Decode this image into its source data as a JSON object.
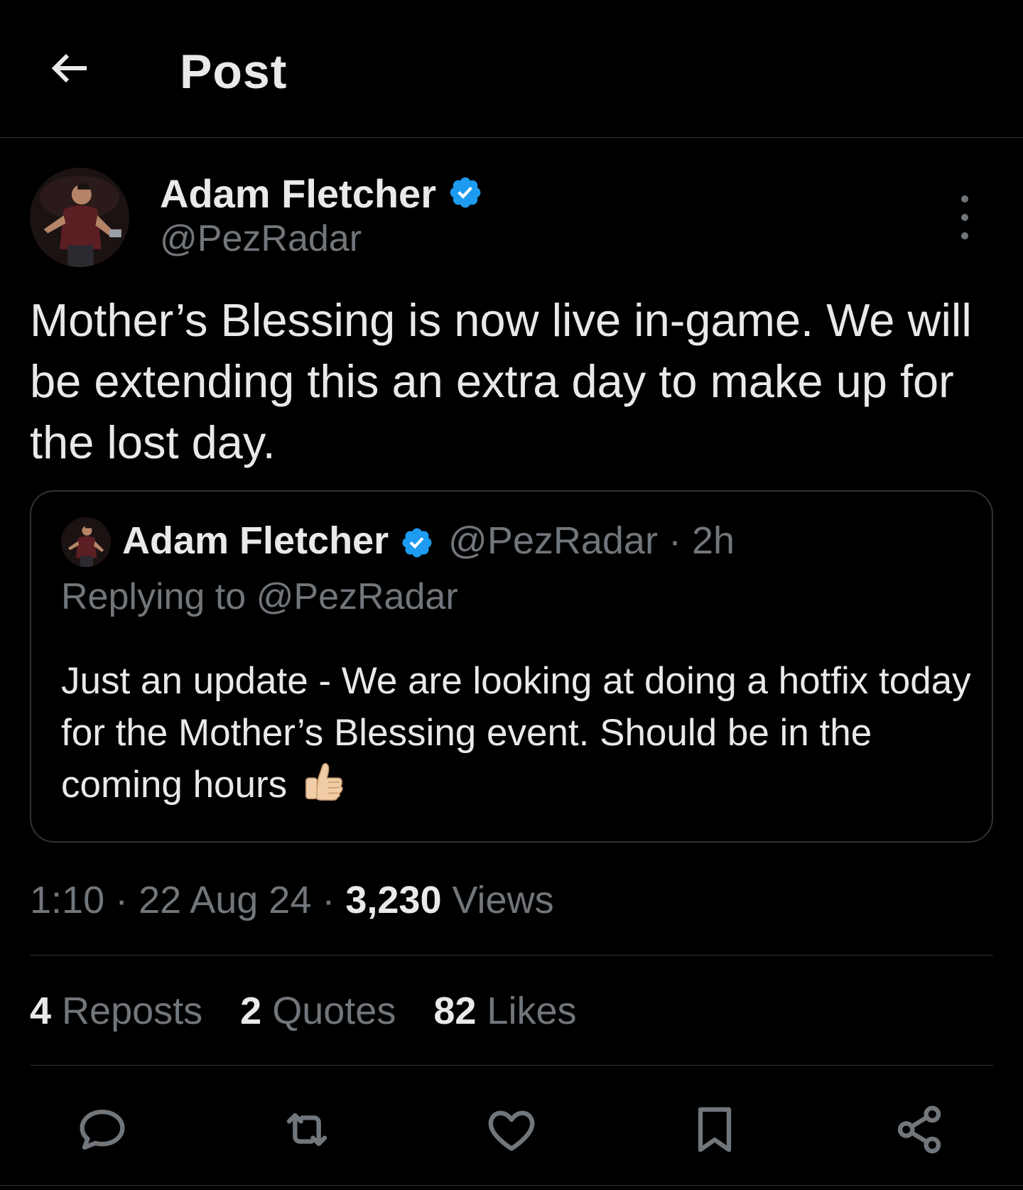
{
  "header": {
    "title": "Post",
    "back_icon": "arrow-left-icon"
  },
  "post": {
    "author_name": "Adam Fletcher",
    "author_handle": "@PezRadar",
    "verified_color": "#1d9bf0",
    "text": "Mother’s Blessing is now live in-game. We will be extending this an extra day to make up for the lost day.",
    "timestamp_time": "1:10",
    "timestamp_sep1": " · ",
    "timestamp_date": "22 Aug 24",
    "timestamp_sep2": " · ",
    "views_count": "3,230",
    "views_label": " Views"
  },
  "quote": {
    "author_name": "Adam Fletcher",
    "author_handle": "@PezRadar",
    "meta_sep": " · ",
    "time_ago": "2h",
    "replying_label": "Replying to ",
    "replying_handle": "@PezRadar",
    "text": "Just an update - We are looking at doing a hotfix today for the Mother’s Blessing event. Should be in the coming hours"
  },
  "stats": {
    "reposts_count": "4",
    "reposts_label": " Reposts",
    "quotes_count": "2",
    "quotes_label": " Quotes",
    "likes_count": "82",
    "likes_label": " Likes"
  },
  "actions": [
    "reply-icon",
    "repost-icon",
    "like-icon",
    "bookmark-icon",
    "share-icon"
  ],
  "colors": {
    "background": "#000000",
    "text_primary": "#e7e9ea",
    "text_secondary": "#71767b",
    "border": "#2f3336",
    "accent": "#1d9bf0"
  }
}
